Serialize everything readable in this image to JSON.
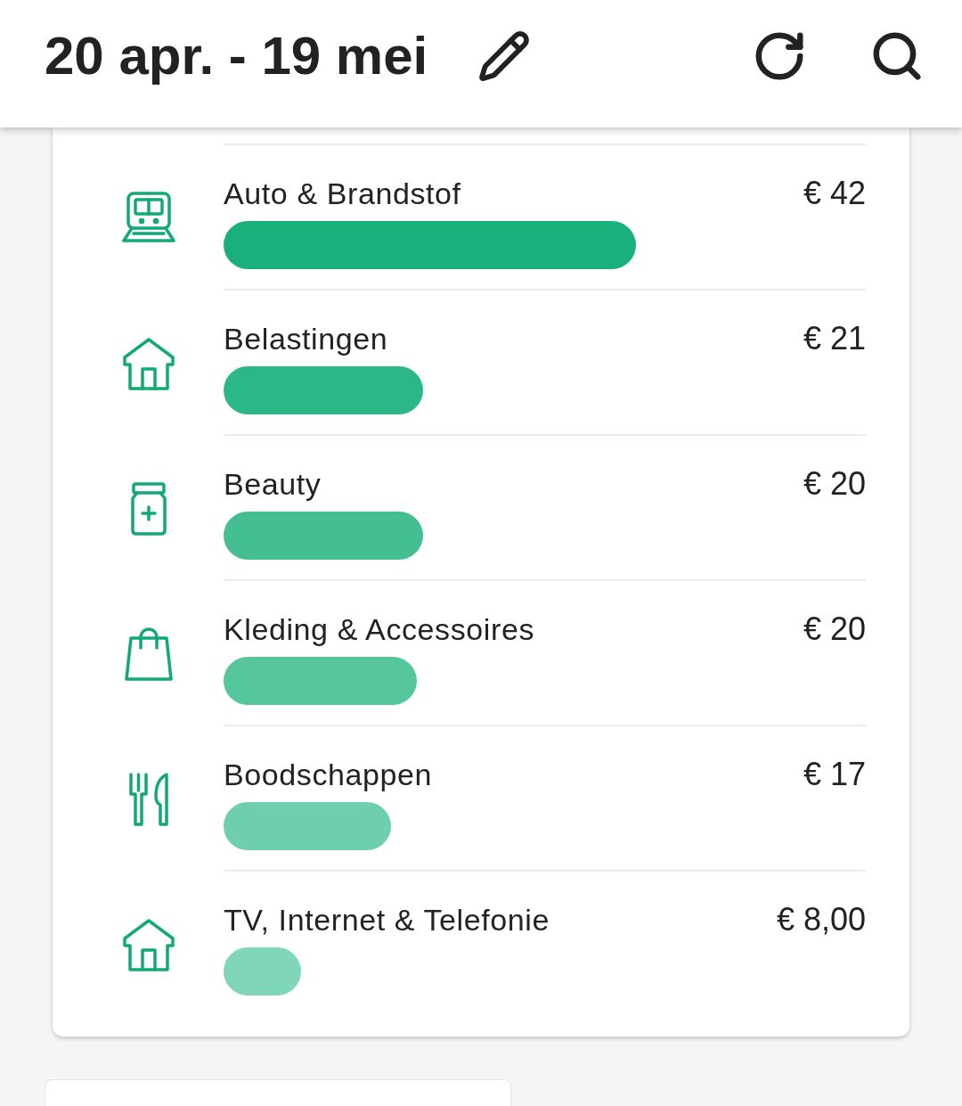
{
  "header": {
    "title": "20 apr. - 19 mei"
  },
  "categories": [
    {
      "kind": "train",
      "name": "Auto & Brandstof",
      "amount": "€ 42",
      "level": 0.642,
      "color": "#19b07b"
    },
    {
      "kind": "house",
      "name": "Belastingen",
      "amount": "€ 21",
      "level": 0.311,
      "color": "#2bb886"
    },
    {
      "kind": "jar",
      "name": "Beauty",
      "amount": "€ 20",
      "level": 0.311,
      "color": "#43bf91"
    },
    {
      "kind": "bag",
      "name": "Kleding & Accessoires",
      "amount": "€ 20",
      "level": 0.301,
      "color": "#56c79d"
    },
    {
      "kind": "cutlery",
      "name": "Boodschappen",
      "amount": "€ 17",
      "level": 0.261,
      "color": "#6dcfab"
    },
    {
      "kind": "house",
      "name": "TV, Internet & Telefonie",
      "amount": "€ 8,00",
      "level": 0.121,
      "color": "#80d6b8"
    }
  ]
}
